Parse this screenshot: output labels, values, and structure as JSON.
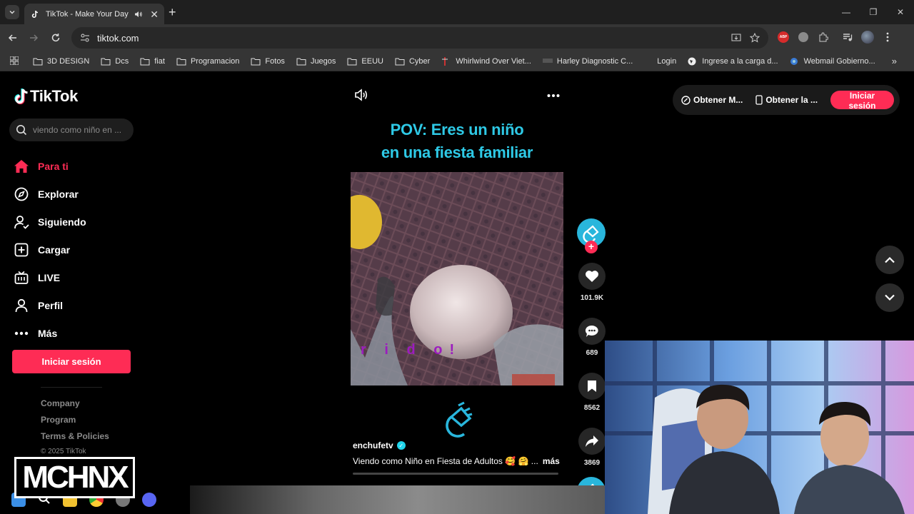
{
  "browser": {
    "tab_title": "TikTok - Make Your Day",
    "url": "tiktok.com",
    "bookmarks": [
      {
        "label": "3D DESIGN"
      },
      {
        "label": "Dcs"
      },
      {
        "label": "fiat"
      },
      {
        "label": "Programacion"
      },
      {
        "label": "Fotos"
      },
      {
        "label": "Juegos"
      },
      {
        "label": "EEUU"
      },
      {
        "label": "Cyber"
      },
      {
        "label": "Whirlwind Over Viet..."
      },
      {
        "label": "Harley Diagnostic C..."
      },
      {
        "label": "Login"
      },
      {
        "label": "Ingrese a la carga d..."
      },
      {
        "label": "Webmail Gobierno..."
      }
    ],
    "abp_label": "ABP"
  },
  "tiktok": {
    "logo_text": "TikTok",
    "search_placeholder": "viendo como niño en ...",
    "nav": [
      {
        "label": "Para ti",
        "icon": "home-icon",
        "active": true
      },
      {
        "label": "Explorar",
        "icon": "compass-icon"
      },
      {
        "label": "Siguiendo",
        "icon": "following-icon"
      },
      {
        "label": "Cargar",
        "icon": "upload-icon"
      },
      {
        "label": "LIVE",
        "icon": "live-icon"
      },
      {
        "label": "Perfil",
        "icon": "profile-icon"
      },
      {
        "label": "Más",
        "icon": "more-icon"
      }
    ],
    "login_label": "Iniciar sesión",
    "footer": {
      "links": [
        "Company",
        "Program",
        "Terms & Policies"
      ],
      "copyright": "© 2025 TikTok"
    },
    "top_right": {
      "coins_label": "Obtener M...",
      "app_label": "Obtener la ...",
      "login_label": "Iniciar sesión"
    },
    "video": {
      "title_line1": "POV: Eres un niño",
      "title_line2": "en una fiesta familiar",
      "overlay_text": "r i d o!",
      "author": "enchufetv",
      "description": "Viendo como Niño en Fiesta de Adultos 🥰 🤗 ...",
      "more_label": "más",
      "likes": "101.9K",
      "comments": "689",
      "saves": "8562",
      "shares": "3869"
    }
  },
  "stream": {
    "watermark": "MCHNX"
  },
  "colors": {
    "tiktok_red": "#fe2c55",
    "title_cyan": "#2ec9e6",
    "brand_blue": "#29b6dc"
  }
}
